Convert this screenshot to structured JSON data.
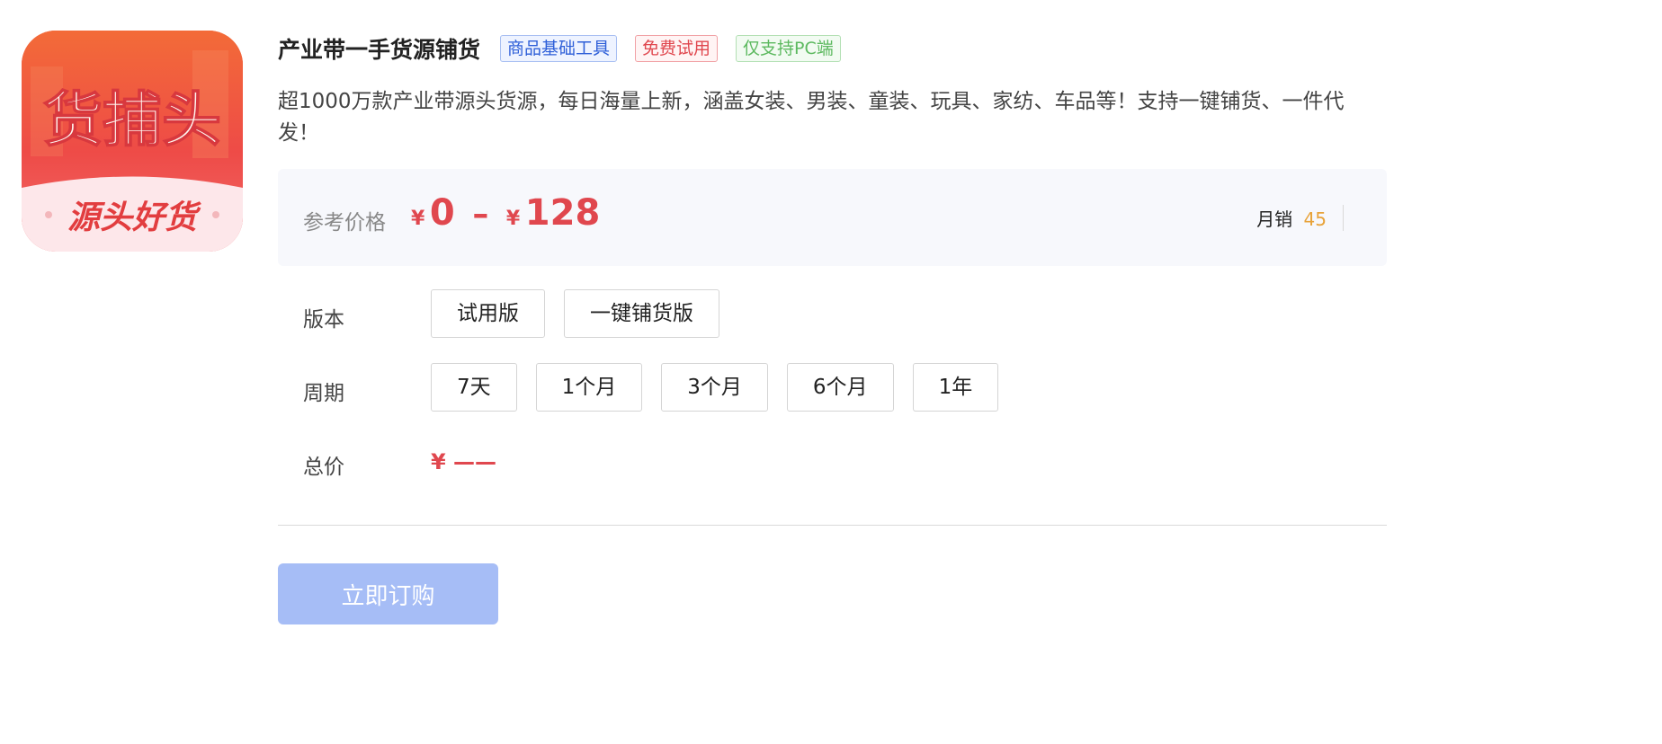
{
  "logo": {
    "main_text": "货捕头",
    "sub_text": "源头好货",
    "colors": {
      "primary": "#ef4f45",
      "bottom": "#fbe3e6"
    }
  },
  "product": {
    "title": "产业带一手货源铺货",
    "tags": [
      "商品基础工具",
      "免费试用",
      "仅支持PC端"
    ],
    "description": "超1000万款产业带源头货源，每日海量上新，涵盖女装、男装、童装、玩具、家纺、车品等！支持一键铺货、一件代发！"
  },
  "price": {
    "label": "参考价格",
    "currency": "¥",
    "min": "0",
    "separator": "–",
    "max": "128",
    "sales_label": "月销",
    "sales_value": "45"
  },
  "version": {
    "label": "版本",
    "options": [
      "试用版",
      "一键铺货版"
    ]
  },
  "period": {
    "label": "周期",
    "options": [
      "7天",
      "1个月",
      "3个月",
      "6个月",
      "1年"
    ]
  },
  "total": {
    "label": "总价",
    "value": "¥ ——"
  },
  "buy_button": "立即订购",
  "colors": {
    "price_red": "#e0474e",
    "sales_orange": "#e8a33a",
    "button_blue": "#a6bdf6"
  }
}
